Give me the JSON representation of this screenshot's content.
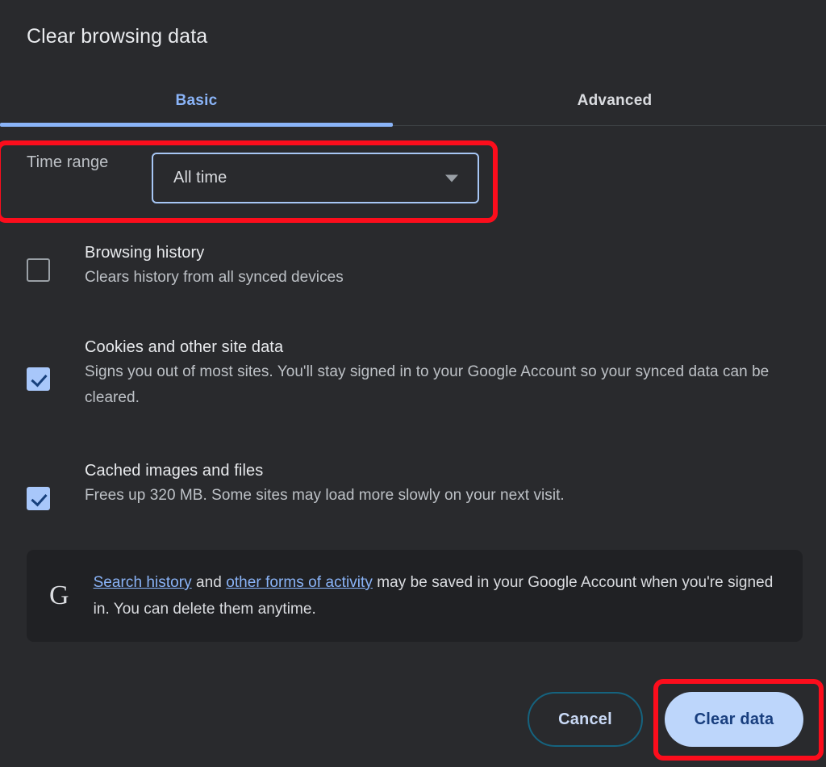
{
  "dialog": {
    "title": "Clear browsing data",
    "background_color": "#292a2d"
  },
  "tabs": [
    {
      "label": "Basic",
      "active": true,
      "color": "#8ab4f8"
    },
    {
      "label": "Advanced",
      "active": false,
      "color": "#dadce0"
    }
  ],
  "time_range": {
    "label": "Time range",
    "selected_value": "All time",
    "arrow_icon": "chevron-down-icon",
    "focused": true,
    "focus_border_color": "#a7c7f5"
  },
  "options": [
    {
      "id": "browsing-history",
      "checked": false,
      "title": "Browsing history",
      "description": "Clears history from all synced devices"
    },
    {
      "id": "cookies-and-site-data",
      "checked": true,
      "title": "Cookies and other site data",
      "description": "Signs you out of most sites. You'll stay signed in to your Google Account so your synced data can be cleared."
    },
    {
      "id": "cached-images-and-files",
      "checked": true,
      "title": "Cached images and files",
      "description": "Frees up 320 MB. Some sites may load more slowly on your next visit."
    }
  ],
  "info_box": {
    "icon": "google-g-icon",
    "icon_glyph": "G",
    "link_1": "Search history",
    "text_1": " and ",
    "link_2": "other forms of activity",
    "text_2": " may be saved in your Google Account when you're signed in. You can delete them anytime.",
    "link_color": "#8ab4f8",
    "background_color": "#202124"
  },
  "footer": {
    "cancel_label": "Cancel",
    "clear_label": "Clear data",
    "cancel_border_color": "#15637f",
    "clear_background_color": "#bdd6fb",
    "clear_text_color": "#183e7e"
  },
  "annotations": {
    "color": "#fc0d1c",
    "highlighted": [
      "time-range-row",
      "clear-data-button"
    ]
  }
}
